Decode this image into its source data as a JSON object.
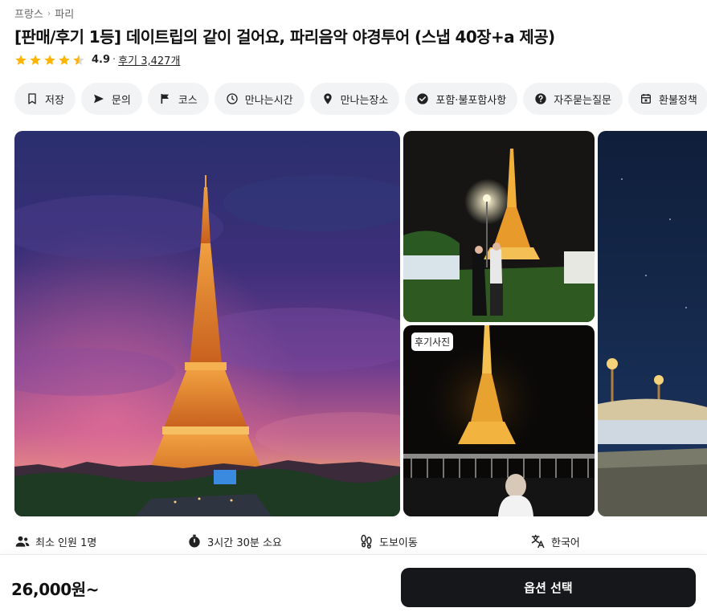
{
  "breadcrumb": {
    "items": [
      "프랑스",
      "파리"
    ]
  },
  "title": "[판매/후기 1등] 데이트립의 같이 걸어요, 파리음악 야경투어 (스냅 40장+a 제공)",
  "rating": {
    "stars": 4.5,
    "score": "4.9",
    "dot": "·",
    "reviews": "후기 3,427개"
  },
  "chips": [
    {
      "label": "저장",
      "icon": "bookmark-icon"
    },
    {
      "label": "문의",
      "icon": "send-icon"
    },
    {
      "label": "코스",
      "icon": "flag-icon"
    },
    {
      "label": "만나는시간",
      "icon": "clock-icon"
    },
    {
      "label": "만나는장소",
      "icon": "location-pin-icon"
    },
    {
      "label": "포함·불포함사항",
      "icon": "check-circle-icon"
    },
    {
      "label": "자주묻는질문",
      "icon": "question-circle-icon"
    },
    {
      "label": "환불정책",
      "icon": "calendar-x-icon"
    }
  ],
  "gallery": {
    "review_badge": "후기사진"
  },
  "info": [
    {
      "label": "최소 인원 1명",
      "icon": "people-icon"
    },
    {
      "label": "3시간 30분 소요",
      "icon": "stopwatch-icon"
    },
    {
      "label": "도보이동",
      "icon": "footprints-icon"
    },
    {
      "label": "한국어",
      "icon": "translate-icon"
    }
  ],
  "footer": {
    "price": "26,000원~",
    "cta": "옵션 선택"
  },
  "colors": {
    "star": "#ffb400",
    "cta_bg": "#16171a",
    "chip_bg": "#f2f3f5"
  }
}
